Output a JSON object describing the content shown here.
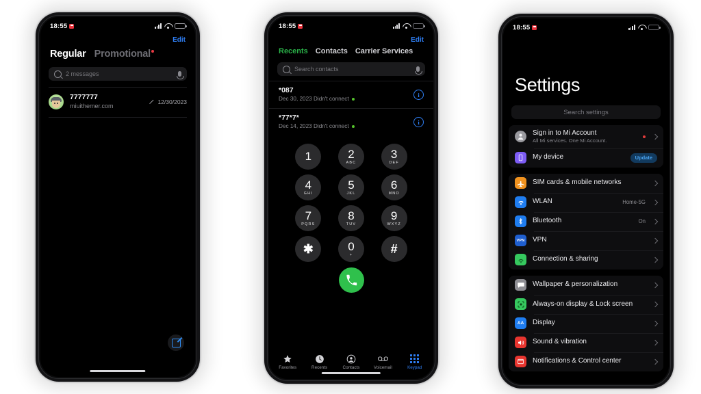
{
  "scene": {
    "background": "#ffffff",
    "device_count": 3
  },
  "colors": {
    "accent_blue": "#2f7ff5",
    "accent_green": "#2bb44a",
    "call_green": "#2fc04c",
    "red_dot": "#ea3b44",
    "screen_black": "#000000"
  },
  "phone1": {
    "name": "messages-app",
    "statusbar": {
      "time": "18:55",
      "badge_icon": "red-notification-badge",
      "signal_icon": "signal-bars-icon",
      "wifi_icon": "wifi-icon",
      "battery_icon": "battery-icon"
    },
    "edit_label": "Edit",
    "tabs": [
      {
        "label": "Regular",
        "active": true
      },
      {
        "label": "Promotional",
        "active": false,
        "badge": true
      }
    ],
    "search": {
      "placeholder": "2 messages",
      "search_icon": "search-icon",
      "mic_icon": "microphone-icon"
    },
    "messages": [
      {
        "avatar": "contact-avatar",
        "title": "7777777",
        "subtitle": "miuithemer.com",
        "date": "12/30/2023",
        "status_icon": "pencil-icon"
      }
    ],
    "compose_icon": "compose-message-icon"
  },
  "phone2": {
    "name": "phone-dialer-app",
    "statusbar": {
      "time": "18:55",
      "badge_icon": "red-notification-badge",
      "signal_icon": "signal-bars-icon",
      "wifi_icon": "wifi-icon",
      "battery_icon": "battery-icon"
    },
    "edit_label": "Edit",
    "tabs": [
      {
        "label": "Recents",
        "active": true
      },
      {
        "label": "Contacts",
        "active": false
      },
      {
        "label": "Carrier Services",
        "active": false
      }
    ],
    "search": {
      "placeholder": "Search contacts",
      "search_icon": "search-icon",
      "mic_icon": "microphone-icon"
    },
    "recents": [
      {
        "number": "*087",
        "detail": "Dec 30, 2023 Didn't connect",
        "sim_icon": "green-sim-dot",
        "info_icon": "info-icon"
      },
      {
        "number": "*77*7*",
        "detail": "Dec 14, 2023 Didn't connect",
        "sim_icon": "green-sim-dot",
        "info_icon": "info-icon"
      }
    ],
    "keypad": [
      {
        "digit": "1",
        "letters": ""
      },
      {
        "digit": "2",
        "letters": "ABC"
      },
      {
        "digit": "3",
        "letters": "DEF"
      },
      {
        "digit": "4",
        "letters": "GHI"
      },
      {
        "digit": "5",
        "letters": "JKL"
      },
      {
        "digit": "6",
        "letters": "MNO"
      },
      {
        "digit": "7",
        "letters": "PQRS"
      },
      {
        "digit": "8",
        "letters": "TUV"
      },
      {
        "digit": "9",
        "letters": "WXYZ"
      },
      {
        "digit": "✱",
        "letters": ""
      },
      {
        "digit": "0",
        "letters": "+"
      },
      {
        "digit": "#",
        "letters": ""
      }
    ],
    "call_button_icon": "call-handset-icon",
    "tabbar": [
      {
        "label": "Favorites",
        "icon": "star-icon",
        "active": false
      },
      {
        "label": "Recents",
        "icon": "clock-icon",
        "active": false
      },
      {
        "label": "Contacts",
        "icon": "person-circle-icon",
        "active": false
      },
      {
        "label": "Voicemail",
        "icon": "voicemail-icon",
        "active": false
      },
      {
        "label": "Keypad",
        "icon": "keypad-grid-icon",
        "active": true
      }
    ]
  },
  "phone3": {
    "name": "settings-app",
    "statusbar": {
      "time": "18:55",
      "badge_icon": "red-notification-badge",
      "signal_icon": "signal-bars-icon",
      "wifi_icon": "wifi-icon",
      "battery_icon": "battery-icon"
    },
    "title": "Settings",
    "search": {
      "placeholder": "Search settings"
    },
    "groups": [
      {
        "rows": [
          {
            "label": "Sign in to Mi Account",
            "sublabel": "All Mi services. One Mi Account.",
            "icon": "account-avatar-icon",
            "icon_bg": "#9a9a9f",
            "icon_glyph": "👤",
            "badge": "red-dot",
            "chevron": true
          },
          {
            "label": "My device",
            "icon": "device-icon",
            "icon_bg": "#7d5cf5",
            "icon_glyph": "▯",
            "action": "Update"
          }
        ]
      },
      {
        "rows": [
          {
            "label": "SIM cards & mobile networks",
            "icon": "sim-network-icon",
            "icon_bg": "#f0921f",
            "icon_glyph": "✈",
            "chevron": true
          },
          {
            "label": "WLAN",
            "icon": "wlan-icon",
            "icon_bg": "#1f7df0",
            "icon_glyph": "📶",
            "value": "Home-5G",
            "chevron": true
          },
          {
            "label": "Bluetooth",
            "icon": "bluetooth-icon",
            "icon_bg": "#1f7df0",
            "icon_glyph": "ᛗ",
            "value": "On",
            "chevron": true
          },
          {
            "label": "VPN",
            "icon": "vpn-icon",
            "icon_bg": "#1f5fd0",
            "icon_glyph": "VPN",
            "chevron": true
          },
          {
            "label": "Connection & sharing",
            "icon": "connection-sharing-icon",
            "icon_bg": "#36c95f",
            "icon_glyph": "ⓦ",
            "chevron": true
          }
        ]
      },
      {
        "rows": [
          {
            "label": "Wallpaper & personalization",
            "icon": "wallpaper-icon",
            "icon_bg": "#8d8d93",
            "icon_glyph": "💬",
            "chevron": true
          },
          {
            "label": "Always-on display & Lock screen",
            "icon": "aod-lockscreen-icon",
            "icon_bg": "#36c95f",
            "icon_glyph": "░",
            "chevron": true
          },
          {
            "label": "Display",
            "icon": "display-icon",
            "icon_bg": "#1f7df0",
            "icon_glyph": "AA",
            "chevron": true
          },
          {
            "label": "Sound & vibration",
            "icon": "sound-vibration-icon",
            "icon_bg": "#e8352f",
            "icon_glyph": "🔊",
            "chevron": true
          },
          {
            "label": "Notifications & Control center",
            "icon": "notifications-icon",
            "icon_bg": "#e8352f",
            "icon_glyph": "▤",
            "chevron": true,
            "clipped": true
          }
        ]
      }
    ]
  }
}
